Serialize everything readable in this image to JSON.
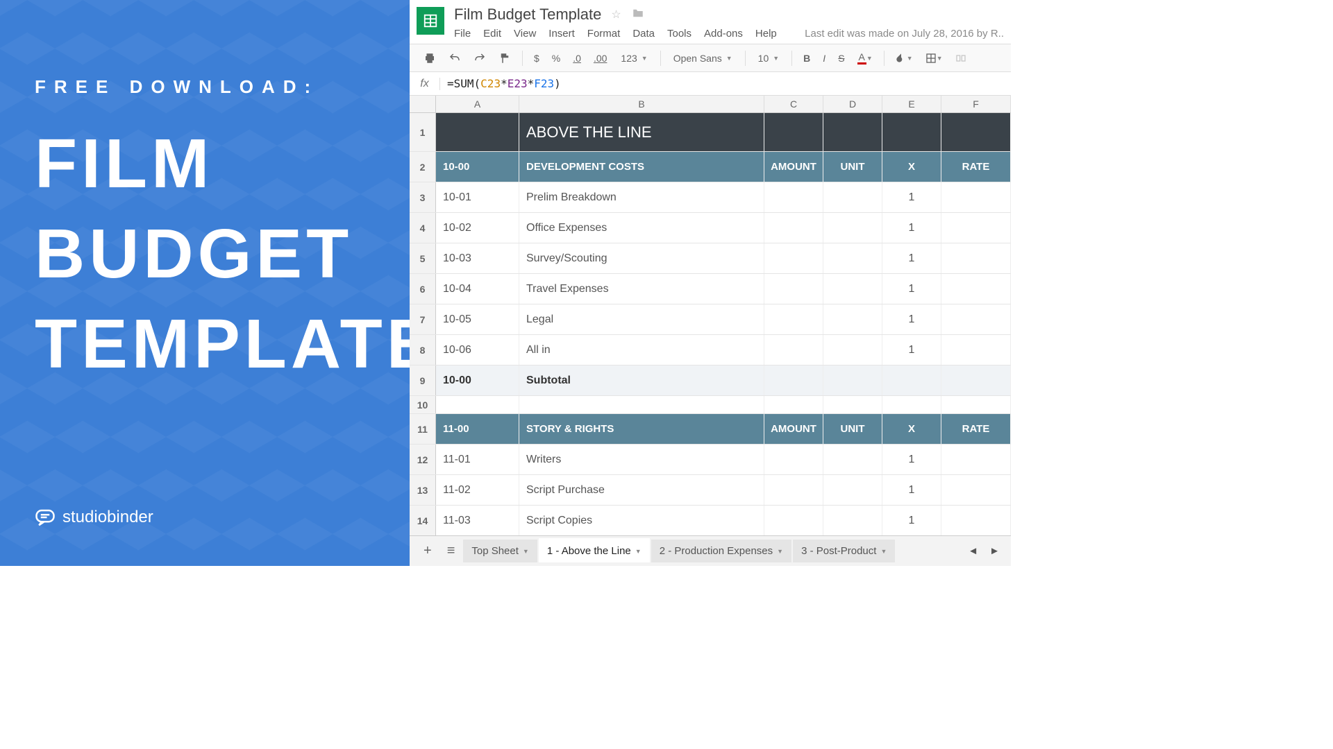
{
  "promo": {
    "subtitle": "FREE DOWNLOAD:",
    "title_line1": "FILM",
    "title_line2": "BUDGET",
    "title_line3": "TEMPLATE",
    "logo_text": "studiobinder"
  },
  "app": {
    "doc_title": "Film Budget Template",
    "last_edit": "Last edit was made on July 28, 2016 by R..",
    "menus": [
      "File",
      "Edit",
      "View",
      "Insert",
      "Format",
      "Data",
      "Tools",
      "Add-ons",
      "Help"
    ],
    "toolbar": {
      "font_family": "Open Sans",
      "font_size": "10",
      "format_123": "123",
      "currency": "$",
      "percent": "%",
      "dec_less": ".0",
      "dec_more": ".00",
      "bold": "B",
      "italic": "I",
      "strike": "S",
      "text_color": "A"
    },
    "formula": {
      "prefix": "=SUM(",
      "ref1": "C23",
      "op1": "*",
      "ref2": "E23",
      "op2": "*",
      "ref3": "F23",
      "suffix": ")"
    },
    "columns": [
      "A",
      "B",
      "C",
      "D",
      "E",
      "F"
    ],
    "rows": [
      {
        "n": "1",
        "type": "title",
        "a": "",
        "b": "ABOVE THE LINE",
        "c": "",
        "d": "",
        "e": "",
        "f": ""
      },
      {
        "n": "2",
        "type": "section",
        "a": "10-00",
        "b": "DEVELOPMENT COSTS",
        "c": "AMOUNT",
        "d": "UNIT",
        "e": "X",
        "f": "RATE"
      },
      {
        "n": "3",
        "type": "data",
        "a": "10-01",
        "b": "Prelim Breakdown",
        "c": "",
        "d": "",
        "e": "1",
        "f": ""
      },
      {
        "n": "4",
        "type": "data",
        "a": "10-02",
        "b": "Office Expenses",
        "c": "",
        "d": "",
        "e": "1",
        "f": ""
      },
      {
        "n": "5",
        "type": "data",
        "a": "10-03",
        "b": "Survey/Scouting",
        "c": "",
        "d": "",
        "e": "1",
        "f": ""
      },
      {
        "n": "6",
        "type": "data",
        "a": "10-04",
        "b": "Travel Expenses",
        "c": "",
        "d": "",
        "e": "1",
        "f": ""
      },
      {
        "n": "7",
        "type": "data",
        "a": "10-05",
        "b": "Legal",
        "c": "",
        "d": "",
        "e": "1",
        "f": ""
      },
      {
        "n": "8",
        "type": "data",
        "a": "10-06",
        "b": "All in",
        "c": "",
        "d": "",
        "e": "1",
        "f": ""
      },
      {
        "n": "9",
        "type": "subtotal",
        "a": "10-00",
        "b": "Subtotal",
        "c": "",
        "d": "",
        "e": "",
        "f": ""
      },
      {
        "n": "10",
        "type": "empty",
        "a": "",
        "b": "",
        "c": "",
        "d": "",
        "e": "",
        "f": ""
      },
      {
        "n": "11",
        "type": "section",
        "a": "11-00",
        "b": "STORY & RIGHTS",
        "c": "AMOUNT",
        "d": "UNIT",
        "e": "X",
        "f": "RATE"
      },
      {
        "n": "12",
        "type": "data",
        "a": "11-01",
        "b": "Writers",
        "c": "",
        "d": "",
        "e": "1",
        "f": ""
      },
      {
        "n": "13",
        "type": "data",
        "a": "11-02",
        "b": "Script Purchase",
        "c": "",
        "d": "",
        "e": "1",
        "f": ""
      },
      {
        "n": "14",
        "type": "data",
        "a": "11-03",
        "b": "Script Copies",
        "c": "",
        "d": "",
        "e": "1",
        "f": ""
      }
    ],
    "tabs": [
      {
        "label": "Top Sheet",
        "active": false
      },
      {
        "label": "1 - Above the Line",
        "active": true
      },
      {
        "label": "2 - Production Expenses",
        "active": false
      },
      {
        "label": "3 - Post-Product",
        "active": false
      }
    ]
  }
}
